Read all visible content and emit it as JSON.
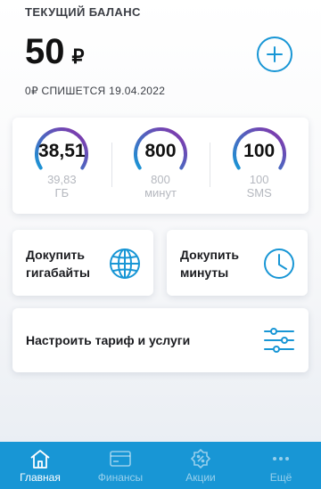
{
  "balance": {
    "header": "ТЕКУЩИЙ БАЛАНС",
    "amount": "50",
    "currency": "₽",
    "charge_note": "0₽ СПИШЕТСЯ 19.04.2022"
  },
  "rests": [
    {
      "value": "38,51",
      "total": "39,83",
      "unit": "ГБ",
      "fraction": 0.97
    },
    {
      "value": "800",
      "total": "800",
      "unit": "минут",
      "fraction": 1.0
    },
    {
      "value": "100",
      "total": "100",
      "unit": "SMS",
      "fraction": 1.0
    }
  ],
  "actions": {
    "buy_gb": {
      "line1": "Докупить",
      "line2": "гигабайты",
      "icon": "globe-icon"
    },
    "buy_min": {
      "line1": "Докупить",
      "line2": "минуты",
      "icon": "clock-icon"
    },
    "tariff": {
      "label": "Настроить тариф и услуги",
      "icon": "sliders-icon"
    }
  },
  "tabs": [
    {
      "label": "Главная",
      "icon": "home-icon",
      "active": true
    },
    {
      "label": "Финансы",
      "icon": "card-icon",
      "active": false
    },
    {
      "label": "Акции",
      "icon": "promo-badge-icon",
      "active": false
    },
    {
      "label": "Ещё",
      "icon": "more-dots-icon",
      "active": false
    }
  ],
  "colors": {
    "accent": "#1896d5",
    "gauge_start": "#1896d5",
    "gauge_end": "#8b2fa8"
  }
}
